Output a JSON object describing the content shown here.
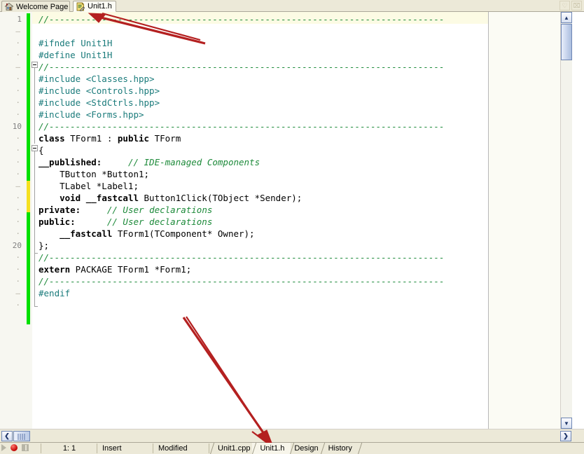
{
  "window": {
    "tabs": [
      {
        "label": "Welcome Page",
        "icon": "home-icon",
        "active": false
      },
      {
        "label": "Unit1.h",
        "icon": "header-file-icon",
        "active": true
      }
    ],
    "controls": [
      {
        "name": "pin-window-button",
        "glyph": "♡"
      },
      {
        "name": "close-window-button",
        "glyph": "⌧"
      }
    ]
  },
  "editor": {
    "gutter": {
      "numbered_lines": {
        "1": "1",
        "10": "10",
        "20": "20"
      },
      "dot_glyph": "·",
      "dash_glyph": "–",
      "change_bar_colors": {
        "saved": "#00e000",
        "unsaved": "#f5e020"
      }
    },
    "lines": [
      {
        "n": 1,
        "tokens": [
          {
            "t": "//---------------------------------------------------------------------------",
            "c": "cmt"
          }
        ]
      },
      {
        "n": 2,
        "tokens": []
      },
      {
        "n": 3,
        "tokens": [
          {
            "t": "#ifndef Unit1H",
            "c": "pre"
          }
        ]
      },
      {
        "n": 4,
        "tokens": [
          {
            "t": "#define Unit1H",
            "c": "pre"
          }
        ]
      },
      {
        "n": 5,
        "tokens": [
          {
            "t": "//---------------------------------------------------------------------------",
            "c": "cmt"
          }
        ]
      },
      {
        "n": 6,
        "tokens": [
          {
            "t": "#include ",
            "c": "pre"
          },
          {
            "t": "<Classes.hpp>",
            "c": "str"
          }
        ]
      },
      {
        "n": 7,
        "tokens": [
          {
            "t": "#include ",
            "c": "pre"
          },
          {
            "t": "<Controls.hpp>",
            "c": "str"
          }
        ]
      },
      {
        "n": 8,
        "tokens": [
          {
            "t": "#include ",
            "c": "pre"
          },
          {
            "t": "<StdCtrls.hpp>",
            "c": "str"
          }
        ]
      },
      {
        "n": 9,
        "tokens": [
          {
            "t": "#include ",
            "c": "pre"
          },
          {
            "t": "<Forms.hpp>",
            "c": "str"
          }
        ]
      },
      {
        "n": 10,
        "tokens": [
          {
            "t": "//---------------------------------------------------------------------------",
            "c": "cmt"
          }
        ]
      },
      {
        "n": 11,
        "tokens": [
          {
            "t": "class",
            "c": "kw"
          },
          {
            "t": " TForm1 : ",
            "c": "id"
          },
          {
            "t": "public",
            "c": "kw"
          },
          {
            "t": " TForm",
            "c": "id"
          }
        ]
      },
      {
        "n": 12,
        "tokens": [
          {
            "t": "{",
            "c": "id"
          }
        ]
      },
      {
        "n": 13,
        "tokens": [
          {
            "t": "__published:",
            "c": "kw"
          },
          {
            "t": "     ",
            "c": "id"
          },
          {
            "t": "// IDE-managed Components",
            "c": "cmt"
          }
        ]
      },
      {
        "n": 14,
        "tokens": [
          {
            "t": "    TButton *Button1;",
            "c": "id"
          }
        ]
      },
      {
        "n": 15,
        "tokens": [
          {
            "t": "    TLabel *Label1;",
            "c": "id"
          }
        ]
      },
      {
        "n": 16,
        "tokens": [
          {
            "t": "    ",
            "c": "id"
          },
          {
            "t": "void __fastcall",
            "c": "kw"
          },
          {
            "t": " Button1Click(TObject *Sender);",
            "c": "id"
          }
        ]
      },
      {
        "n": 17,
        "tokens": [
          {
            "t": "private:",
            "c": "kw"
          },
          {
            "t": "     ",
            "c": "id"
          },
          {
            "t": "// User declarations",
            "c": "cmt"
          }
        ]
      },
      {
        "n": 18,
        "tokens": [
          {
            "t": "public:",
            "c": "kw"
          },
          {
            "t": "      ",
            "c": "id"
          },
          {
            "t": "// User declarations",
            "c": "cmt"
          }
        ]
      },
      {
        "n": 19,
        "tokens": [
          {
            "t": "    ",
            "c": "id"
          },
          {
            "t": "__fastcall",
            "c": "kw"
          },
          {
            "t": " TForm1(TComponent* Owner);",
            "c": "id"
          }
        ]
      },
      {
        "n": 20,
        "tokens": [
          {
            "t": "};",
            "c": "id"
          }
        ]
      },
      {
        "n": 21,
        "tokens": [
          {
            "t": "//---------------------------------------------------------------------------",
            "c": "cmt"
          }
        ]
      },
      {
        "n": 22,
        "tokens": [
          {
            "t": "extern",
            "c": "kw"
          },
          {
            "t": " PACKAGE TForm1 *Form1;",
            "c": "id"
          }
        ]
      },
      {
        "n": 23,
        "tokens": [
          {
            "t": "//---------------------------------------------------------------------------",
            "c": "cmt"
          }
        ]
      },
      {
        "n": 24,
        "tokens": [
          {
            "t": "#endif",
            "c": "pre"
          }
        ]
      }
    ],
    "scrollbars": {
      "v_up_glyph": "▲",
      "v_down_glyph": "▼",
      "h_left_glyph": "❮",
      "h_right_glyph": "❯"
    }
  },
  "statusbar": {
    "cursor_position": "1: 1",
    "insert_mode": "Insert",
    "modified_state": "Modified",
    "debug_buttons": [
      {
        "name": "run-button"
      },
      {
        "name": "record-button"
      },
      {
        "name": "pause-button"
      }
    ],
    "view_tabs": [
      {
        "label": "Unit1.cpp",
        "active": false
      },
      {
        "label": "Unit1.h",
        "active": true
      },
      {
        "label": "Design",
        "active": false
      },
      {
        "label": "History",
        "active": false
      }
    ]
  },
  "annotations": {
    "arrow_color": "#b42020",
    "arrows": [
      {
        "name": "arrow-to-unit1h-top-tab",
        "points_to": "Unit1.h"
      },
      {
        "name": "arrow-to-unit1h-bottom-tab",
        "points_to": "Unit1.h"
      }
    ]
  }
}
